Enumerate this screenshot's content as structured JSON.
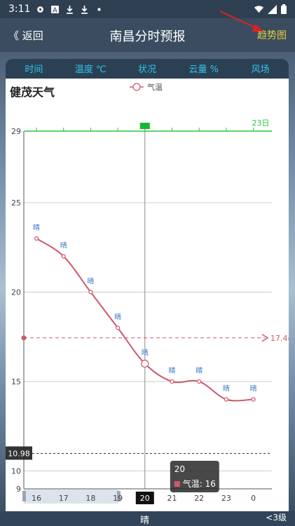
{
  "status": {
    "time": "3:11",
    "icons_left": [
      "gear-icon",
      "a-icon",
      "download-icon",
      "download-icon",
      "dot-icon"
    ],
    "icons_right": [
      "wifi-icon",
      "signal-icon",
      "battery-icon"
    ]
  },
  "appbar": {
    "back_label": "《 返回",
    "title": "南昌分时预报",
    "trend_label": "趋势图",
    "trend_color": "#e6d03c"
  },
  "table_header": {
    "columns": [
      "时间",
      "温度 ℃",
      "状况",
      "云量 %",
      "风场"
    ],
    "color": "#2fc6ea"
  },
  "card": {
    "title": "健茂天气"
  },
  "chart_data": {
    "type": "line",
    "x": [
      "16",
      "17",
      "18",
      "19",
      "20",
      "21",
      "22",
      "23",
      "0"
    ],
    "series": [
      {
        "name": "气温",
        "values": [
          23,
          22,
          20,
          18,
          16,
          15,
          15,
          14,
          14
        ],
        "color": "#cc5a6e",
        "point_labels": [
          "晴",
          "晴",
          "晴",
          "晴",
          "晴",
          "晴",
          "晴",
          "晴",
          "晴"
        ]
      }
    ],
    "ylim": [
      9,
      29
    ],
    "yticks": [
      9,
      10,
      15,
      20,
      25,
      29
    ],
    "top_limit": 29,
    "top_limit_label": "23日",
    "average_line": 17.44,
    "average_label": "17.44",
    "min_line": 10.98,
    "min_label": "10.98",
    "selected_x": "20",
    "tooltip": {
      "title": "20",
      "label": "气温: 16"
    },
    "legend": "top-center",
    "grid": true
  },
  "bottom": {
    "current_status": "晴",
    "wind_label": "<3级"
  }
}
